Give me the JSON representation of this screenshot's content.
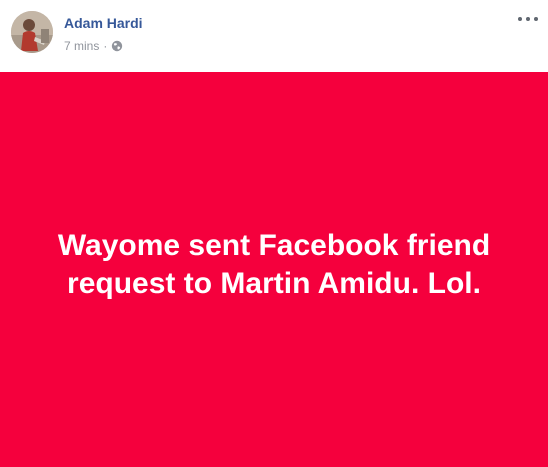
{
  "post": {
    "author": {
      "name": "Adam Hardi",
      "avatar_icon": "profile-photo"
    },
    "timestamp": "7 mins",
    "separator": "·",
    "audience_icon": "globe-icon",
    "menu_icon": "more-options-icon",
    "message": "Wayome sent Facebook friend request to Martin Amidu. Lol.",
    "colors": {
      "background": "#f5003d",
      "text": "#ffffff",
      "author_name": "#365899",
      "meta_text": "#90949c"
    }
  }
}
